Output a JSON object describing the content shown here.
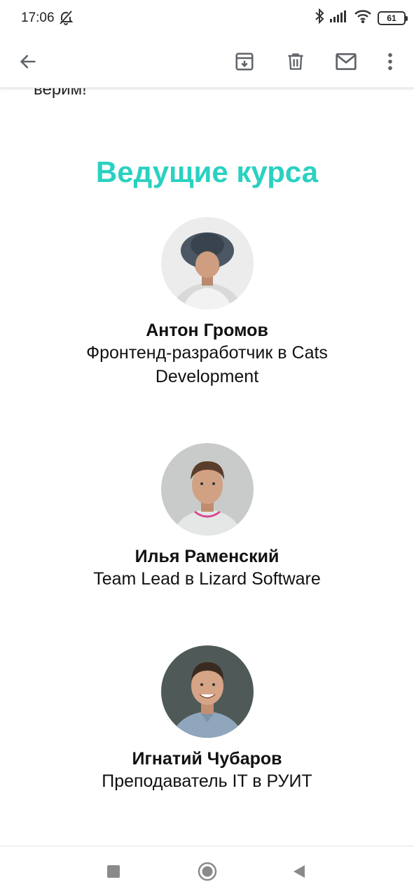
{
  "status": {
    "time": "17:06",
    "battery": "61"
  },
  "email": {
    "cut_text": "верим!",
    "section_title": "Ведущие курса",
    "instructors": [
      {
        "name": "Антон Громов",
        "role": "Фронтенд-разработчик в Cats Development"
      },
      {
        "name": "Илья Раменский",
        "role": "Team Lead в Lizard Software"
      },
      {
        "name": "Игнатий Чубаров",
        "role": "Преподаватель IT в РУИТ"
      }
    ]
  },
  "colors": {
    "accent": "#2ad1c1",
    "icon": "#5f6368"
  },
  "icons": {
    "toolbar": [
      "back-arrow-icon",
      "archive-icon",
      "delete-icon",
      "mark-unread-icon",
      "more-vert-icon"
    ],
    "status": [
      "mute-icon",
      "bluetooth-icon",
      "signal-icon",
      "wifi-icon",
      "battery-icon"
    ],
    "nav": [
      "recents-icon",
      "home-icon",
      "back-icon"
    ]
  }
}
